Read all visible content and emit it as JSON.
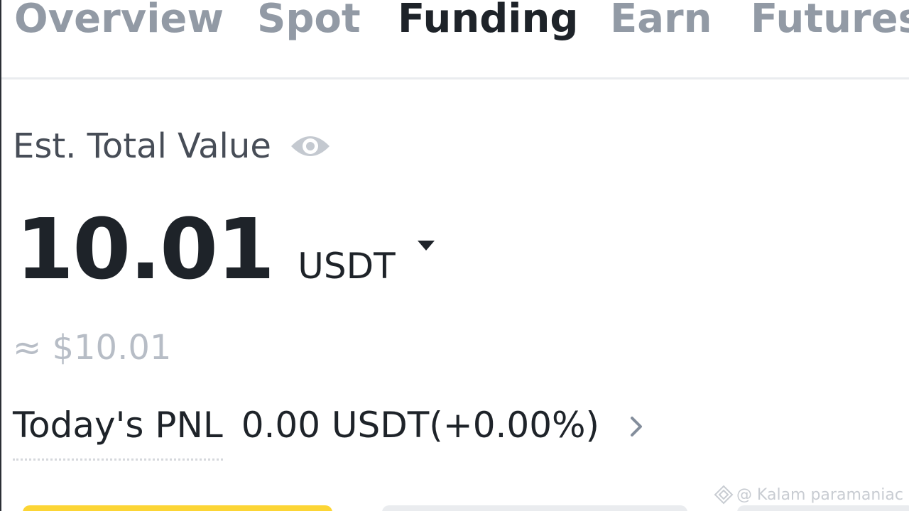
{
  "tabs": [
    {
      "label": "Overview",
      "active": false
    },
    {
      "label": "Spot",
      "active": false
    },
    {
      "label": "Funding",
      "active": true
    },
    {
      "label": "Earn",
      "active": false
    },
    {
      "label": "Futures",
      "active": false
    }
  ],
  "balance": {
    "label": "Est. Total Value",
    "value": "10.01",
    "unit": "USDT",
    "approx": "≈ $10.01",
    "visibility_icon": "eye-icon",
    "unit_selector_icon": "caret-down-icon"
  },
  "pnl": {
    "label": "Today's PNL",
    "value": "0.00 USDT(+0.00%)",
    "icon": "chevron-right-icon"
  },
  "watermark": {
    "text": "@ Kalam paramaniac",
    "logo_icon": "binance-logo-icon"
  },
  "colors": {
    "text_primary": "#1e2329",
    "text_muted": "#929aa5",
    "accent_yellow": "#fcd535",
    "button_grey": "#eaecef"
  }
}
